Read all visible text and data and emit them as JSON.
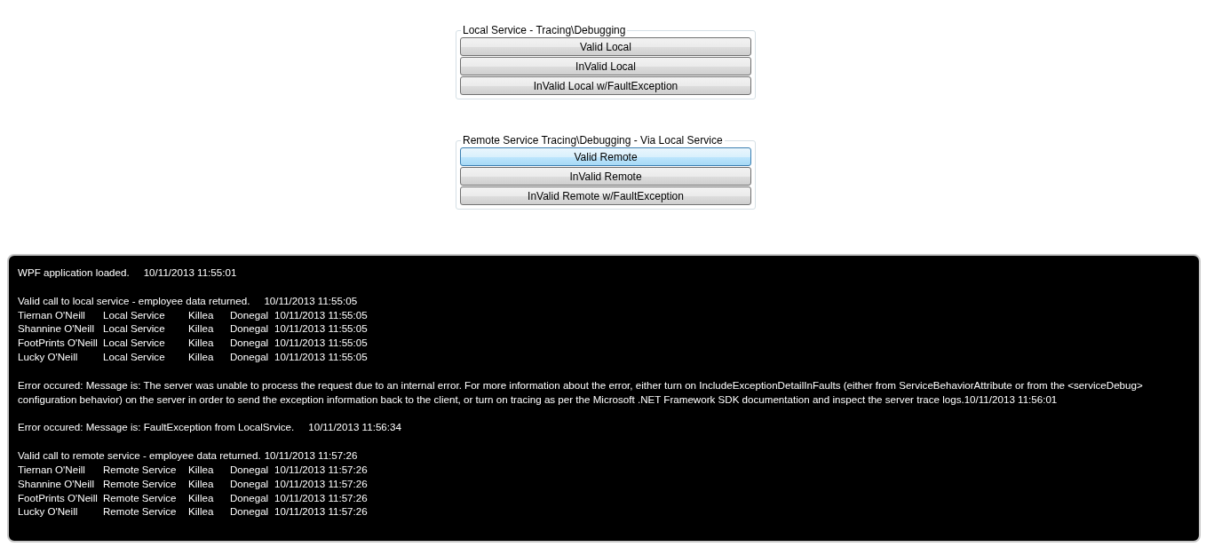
{
  "groups": [
    {
      "title": "Local Service - Tracing\\Debugging",
      "buttons": [
        {
          "label": "Valid Local",
          "highlighted": false
        },
        {
          "label": "InValid Local",
          "highlighted": false
        },
        {
          "label": "InValid Local w/FaultException",
          "highlighted": false
        }
      ]
    },
    {
      "title": "Remote Service Tracing\\Debugging - Via Local Service",
      "buttons": [
        {
          "label": "Valid Remote",
          "highlighted": true
        },
        {
          "label": "InValid Remote",
          "highlighted": false
        },
        {
          "label": "InValid Remote w/FaultException",
          "highlighted": false
        }
      ]
    }
  ],
  "log": [
    [
      {
        "kind": "message",
        "text": "WPF application loaded.",
        "time": "10/11/2013 11:55:01"
      }
    ],
    [
      {
        "kind": "message",
        "text": "Valid call to local service - employee data returned.",
        "time": "10/11/2013 11:55:05"
      },
      {
        "kind": "record",
        "cells": [
          "Tiernan O'Neill",
          "Local Service",
          "Killea",
          "Donegal",
          "10/11/2013 11:55:05"
        ]
      },
      {
        "kind": "record",
        "cells": [
          "Shannine O'Neill",
          "Local Service",
          "Killea",
          "Donegal",
          "10/11/2013 11:55:05"
        ]
      },
      {
        "kind": "record",
        "cells": [
          "FootPrints O'Neill",
          "Local Service",
          "Killea",
          "Donegal",
          "10/11/2013 11:55:05"
        ]
      },
      {
        "kind": "record",
        "cells": [
          "Lucky O'Neill",
          "Local Service",
          "Killea",
          "Donegal",
          "10/11/2013 11:55:05"
        ]
      }
    ],
    [
      {
        "kind": "paragraph",
        "text": "Error occured: Message is: The server was unable to process the request due to an internal error.  For more information about the error, either turn on IncludeExceptionDetailInFaults (either from ServiceBehaviorAttribute or from the <serviceDebug> configuration behavior) on the server in order to send the exception information back to the client, or turn on tracing as per the Microsoft .NET Framework SDK documentation and inspect the server trace logs.10/11/2013 11:56:01"
      }
    ],
    [
      {
        "kind": "message",
        "text": "Error occured: Message is: FaultException from LocalSrvice.",
        "time": "10/11/2013 11:56:34"
      }
    ],
    [
      {
        "kind": "message",
        "text": "Valid call to remote service - employee data returned.",
        "time": "10/11/2013 11:57:26"
      },
      {
        "kind": "record",
        "cells": [
          "Tiernan O'Neill",
          "Remote Service",
          "Killea",
          "Donegal",
          "10/11/2013 11:57:26"
        ]
      },
      {
        "kind": "record",
        "cells": [
          "Shannine O'Neill",
          "Remote Service",
          "Killea",
          "Donegal",
          "10/11/2013 11:57:26"
        ]
      },
      {
        "kind": "record",
        "cells": [
          "FootPrints O'Neill",
          "Remote Service",
          "Killea",
          "Donegal",
          "10/11/2013 11:57:26"
        ]
      },
      {
        "kind": "record",
        "cells": [
          "Lucky O'Neill",
          "Remote Service",
          "Killea",
          "Donegal",
          "10/11/2013 11:57:26"
        ]
      }
    ]
  ]
}
